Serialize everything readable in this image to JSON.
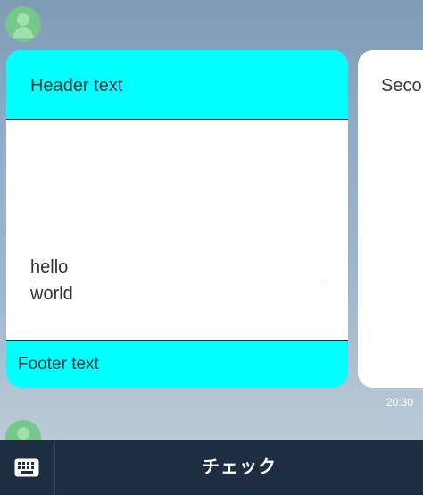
{
  "timeline": {
    "top_avatar": {
      "icon": "person-icon"
    },
    "bottom_avatar": {
      "icon": "person-icon"
    },
    "cards": [
      {
        "header": "Header text",
        "body_lines": [
          "hello",
          "world"
        ],
        "footer": "Footer text"
      },
      {
        "header": "Seco"
      }
    ],
    "timestamp": "20:30"
  },
  "bottom_bar": {
    "keyboard_icon": "keyboard-icon",
    "label": "チェック"
  },
  "colors": {
    "accent_cyan": "#00ffff",
    "card_background": "#ffffff",
    "avatar_green": "#78c78a",
    "bottom_bar": "#1f2d43",
    "background_blue": "#90acc6"
  }
}
